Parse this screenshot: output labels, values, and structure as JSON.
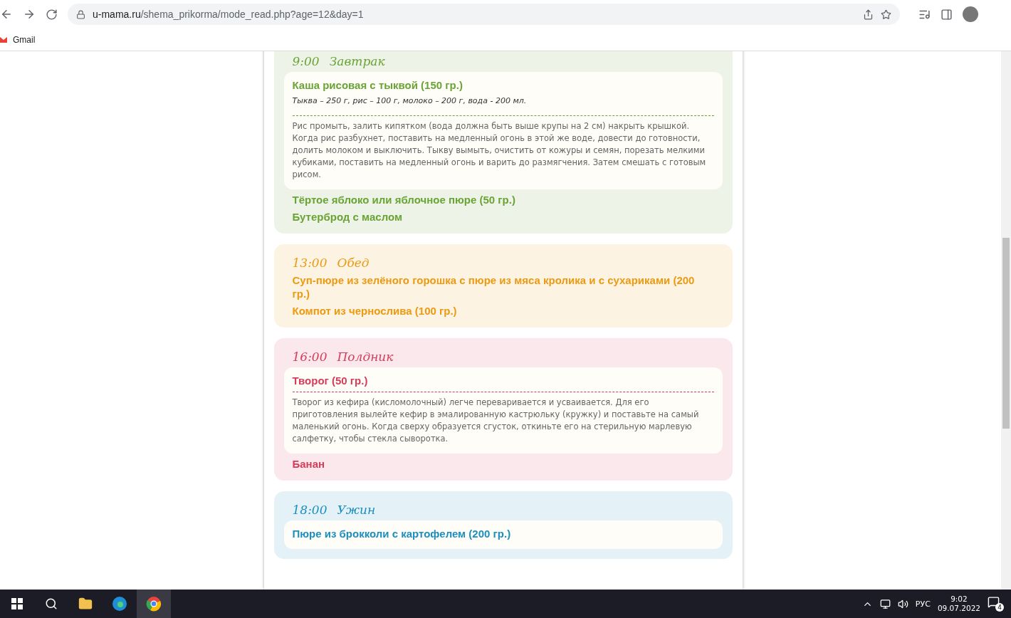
{
  "browser": {
    "url_host": "u-mama.ru",
    "url_path": "/shema_prikorma/mode_read.php?age=12&day=1",
    "bookmarks": [
      {
        "label": "Gmail"
      }
    ]
  },
  "meals": [
    {
      "time": "9:00",
      "title": "Завтрак",
      "color": "#6aa336",
      "items": [
        {
          "kind": "recipe",
          "title": "Каша рисовая с тыквой (150 гр.)",
          "ingredients": "Тыква – 250 г, рис – 100 г, молоко – 200 г, вода - 200 мл.",
          "text": "Рис промыть, залить кипятком (вода должна быть выше крупы на 2 см) накрыть крышкой. Когда рис разбухнет, поставить на медленный огонь в этой же воде, довести до готовности, долить молоком и выключить. Тыкву вымыть, очистить от кожуры и семян, порезать мелкими кубиками, поставить на медленный огонь и варить до размягчения. Затем смешать с готовым рисом."
        },
        {
          "kind": "simple",
          "title": "Тёртое яблоко или яблочное пюре (50 гр.)"
        },
        {
          "kind": "simple",
          "title": "Бутерброд с маслом"
        }
      ]
    },
    {
      "time": "13:00",
      "title": "Обед",
      "color": "#eb9a12",
      "items": [
        {
          "kind": "simple",
          "title": "Суп-пюре из зелёного горошка с пюре из мяса кролика и с сухариками (200 гр.)"
        },
        {
          "kind": "simple",
          "title": "Компот из чернослива (100 гр.)"
        }
      ]
    },
    {
      "time": "16:00",
      "title": "Полдник",
      "color": "#d43d5a",
      "items": [
        {
          "kind": "recipe",
          "title": "Творог (50 гр.)",
          "text": "Творог из кефира (кисломолочный) легче переваривается и усваивается. Для его приготовления вылейте кефир в эмалированную кастрюльку (кружку) и поставьте на самый маленький огонь. Когда сверху образуется сгусток, откиньте его на стерильную марлевую салфетку, чтобы стекла сыворотка."
        },
        {
          "kind": "simple",
          "title": "Банан"
        }
      ]
    },
    {
      "time": "18:00",
      "title": "Ужин",
      "color": "#1b8fbf",
      "items": [
        {
          "kind": "recipe",
          "title": "Пюре из брокколи с картофелем (200 гр.)"
        }
      ]
    }
  ],
  "taskbar": {
    "language": "РУС",
    "time": "9:02",
    "date": "09.07.2022",
    "notifications": "4"
  }
}
